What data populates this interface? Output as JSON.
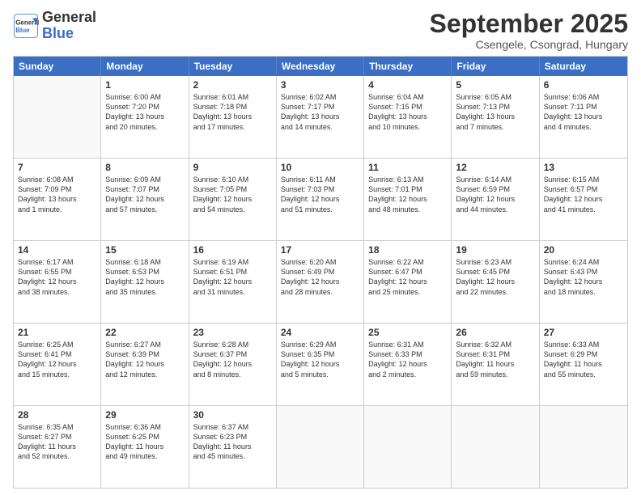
{
  "logo": {
    "line1": "General",
    "line2": "Blue"
  },
  "title": "September 2025",
  "subtitle": "Csengele, Csongrad, Hungary",
  "days": [
    "Sunday",
    "Monday",
    "Tuesday",
    "Wednesday",
    "Thursday",
    "Friday",
    "Saturday"
  ],
  "weeks": [
    [
      {
        "day": "",
        "info": ""
      },
      {
        "day": "1",
        "info": "Sunrise: 6:00 AM\nSunset: 7:20 PM\nDaylight: 13 hours\nand 20 minutes."
      },
      {
        "day": "2",
        "info": "Sunrise: 6:01 AM\nSunset: 7:18 PM\nDaylight: 13 hours\nand 17 minutes."
      },
      {
        "day": "3",
        "info": "Sunrise: 6:02 AM\nSunset: 7:17 PM\nDaylight: 13 hours\nand 14 minutes."
      },
      {
        "day": "4",
        "info": "Sunrise: 6:04 AM\nSunset: 7:15 PM\nDaylight: 13 hours\nand 10 minutes."
      },
      {
        "day": "5",
        "info": "Sunrise: 6:05 AM\nSunset: 7:13 PM\nDaylight: 13 hours\nand 7 minutes."
      },
      {
        "day": "6",
        "info": "Sunrise: 6:06 AM\nSunset: 7:11 PM\nDaylight: 13 hours\nand 4 minutes."
      }
    ],
    [
      {
        "day": "7",
        "info": "Sunrise: 6:08 AM\nSunset: 7:09 PM\nDaylight: 13 hours\nand 1 minute."
      },
      {
        "day": "8",
        "info": "Sunrise: 6:09 AM\nSunset: 7:07 PM\nDaylight: 12 hours\nand 57 minutes."
      },
      {
        "day": "9",
        "info": "Sunrise: 6:10 AM\nSunset: 7:05 PM\nDaylight: 12 hours\nand 54 minutes."
      },
      {
        "day": "10",
        "info": "Sunrise: 6:11 AM\nSunset: 7:03 PM\nDaylight: 12 hours\nand 51 minutes."
      },
      {
        "day": "11",
        "info": "Sunrise: 6:13 AM\nSunset: 7:01 PM\nDaylight: 12 hours\nand 48 minutes."
      },
      {
        "day": "12",
        "info": "Sunrise: 6:14 AM\nSunset: 6:59 PM\nDaylight: 12 hours\nand 44 minutes."
      },
      {
        "day": "13",
        "info": "Sunrise: 6:15 AM\nSunset: 6:57 PM\nDaylight: 12 hours\nand 41 minutes."
      }
    ],
    [
      {
        "day": "14",
        "info": "Sunrise: 6:17 AM\nSunset: 6:55 PM\nDaylight: 12 hours\nand 38 minutes."
      },
      {
        "day": "15",
        "info": "Sunrise: 6:18 AM\nSunset: 6:53 PM\nDaylight: 12 hours\nand 35 minutes."
      },
      {
        "day": "16",
        "info": "Sunrise: 6:19 AM\nSunset: 6:51 PM\nDaylight: 12 hours\nand 31 minutes."
      },
      {
        "day": "17",
        "info": "Sunrise: 6:20 AM\nSunset: 6:49 PM\nDaylight: 12 hours\nand 28 minutes."
      },
      {
        "day": "18",
        "info": "Sunrise: 6:22 AM\nSunset: 6:47 PM\nDaylight: 12 hours\nand 25 minutes."
      },
      {
        "day": "19",
        "info": "Sunrise: 6:23 AM\nSunset: 6:45 PM\nDaylight: 12 hours\nand 22 minutes."
      },
      {
        "day": "20",
        "info": "Sunrise: 6:24 AM\nSunset: 6:43 PM\nDaylight: 12 hours\nand 18 minutes."
      }
    ],
    [
      {
        "day": "21",
        "info": "Sunrise: 6:25 AM\nSunset: 6:41 PM\nDaylight: 12 hours\nand 15 minutes."
      },
      {
        "day": "22",
        "info": "Sunrise: 6:27 AM\nSunset: 6:39 PM\nDaylight: 12 hours\nand 12 minutes."
      },
      {
        "day": "23",
        "info": "Sunrise: 6:28 AM\nSunset: 6:37 PM\nDaylight: 12 hours\nand 8 minutes."
      },
      {
        "day": "24",
        "info": "Sunrise: 6:29 AM\nSunset: 6:35 PM\nDaylight: 12 hours\nand 5 minutes."
      },
      {
        "day": "25",
        "info": "Sunrise: 6:31 AM\nSunset: 6:33 PM\nDaylight: 12 hours\nand 2 minutes."
      },
      {
        "day": "26",
        "info": "Sunrise: 6:32 AM\nSunset: 6:31 PM\nDaylight: 11 hours\nand 59 minutes."
      },
      {
        "day": "27",
        "info": "Sunrise: 6:33 AM\nSunset: 6:29 PM\nDaylight: 11 hours\nand 55 minutes."
      }
    ],
    [
      {
        "day": "28",
        "info": "Sunrise: 6:35 AM\nSunset: 6:27 PM\nDaylight: 11 hours\nand 52 minutes."
      },
      {
        "day": "29",
        "info": "Sunrise: 6:36 AM\nSunset: 6:25 PM\nDaylight: 11 hours\nand 49 minutes."
      },
      {
        "day": "30",
        "info": "Sunrise: 6:37 AM\nSunset: 6:23 PM\nDaylight: 11 hours\nand 45 minutes."
      },
      {
        "day": "",
        "info": ""
      },
      {
        "day": "",
        "info": ""
      },
      {
        "day": "",
        "info": ""
      },
      {
        "day": "",
        "info": ""
      }
    ]
  ]
}
